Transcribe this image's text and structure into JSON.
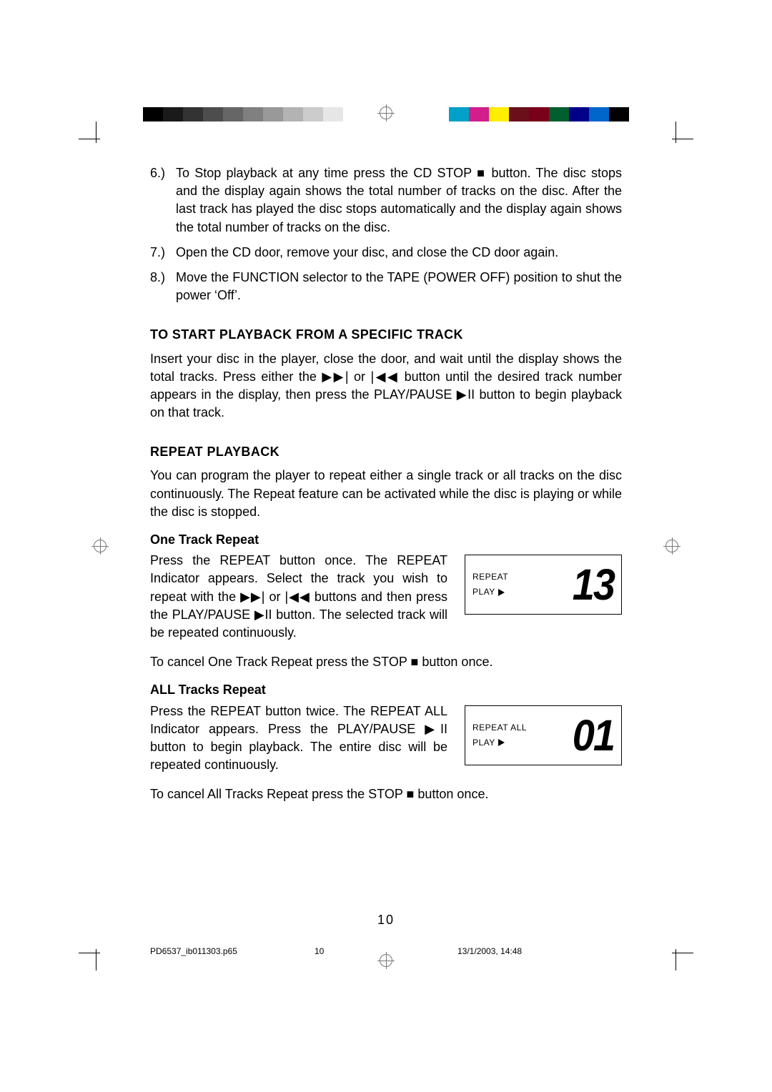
{
  "swatches_left": [
    "#000000",
    "#1a1a1a",
    "#333333",
    "#4d4d4d",
    "#666666",
    "#808080",
    "#999999",
    "#b3b3b3",
    "#cccccc",
    "#e6e6e6",
    "#ffffff"
  ],
  "swatches_right": [
    "#00a0c8",
    "#d11e8b",
    "#ffee00",
    "#6b0f1a",
    "#7a0019",
    "#005f2f",
    "#00008b",
    "#0066cc",
    "#000000"
  ],
  "list": [
    {
      "num": "6.)",
      "text": "To Stop playback at any time press the CD STOP ■ button. The disc stops and the display again shows the total number of tracks on the disc. After the last track has played the disc stops automatically and the display again shows the total number of tracks on the disc."
    },
    {
      "num": "7.)",
      "text": "Open the CD door, remove your disc, and close the CD door again."
    },
    {
      "num": "8.)",
      "text": "Move the FUNCTION selector to the TAPE (POWER OFF) position to shut the power ‘Off’."
    }
  ],
  "h1": "TO START PLAYBACK FROM A SPECIFIC TRACK",
  "p1": "Insert your disc in the player, close the door, and wait until the display shows the total tracks. Press either the ▶▶| or |◀◀ button until the desired track number appears in the display, then press the PLAY/PAUSE ▶II button to begin playback on that track.",
  "h2": "REPEAT PLAYBACK",
  "p2": "You can program the player to repeat either a single track or all tracks on the disc continuously. The Repeat feature can be activated while the disc is playing or while the disc is stopped.",
  "sub1": "One Track Repeat",
  "p3": "Press the REPEAT button once. The REPEAT Indicator appears. Select the track you wish to repeat with the ▶▶| or |◀◀ buttons and then press the PLAY/PAUSE ▶II button. The selected track will be repeated continuously.",
  "p3b": "To cancel One Track Repeat press the STOP ■ button once.",
  "lcd1": {
    "l1": "REPEAT",
    "l2": "PLAY",
    "digits": "13"
  },
  "sub2": "ALL Tracks Repeat",
  "p4": "Press the REPEAT button twice. The REPEAT ALL Indicator appears. Press the PLAY/PAUSE ▶II button to begin playback. The entire disc will be repeated continuously.",
  "p4b": "To cancel All Tracks Repeat press the STOP ■ button once.",
  "lcd2": {
    "l1": "REPEAT ALL",
    "l2": "PLAY",
    "digits": "01"
  },
  "pagenum": "10",
  "footer": {
    "file": "PD6537_ib011303.p65",
    "page": "10",
    "date": "13/1/2003, 14:48"
  }
}
